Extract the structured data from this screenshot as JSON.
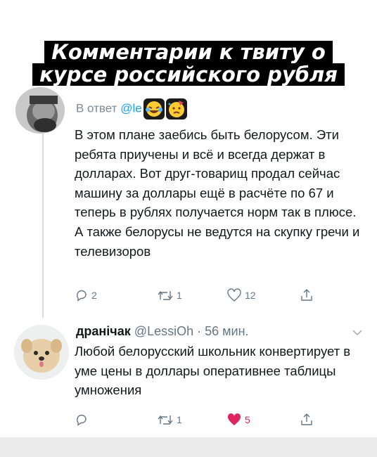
{
  "headline": {
    "line1": "Комментарии к твиту о",
    "line2": "курсе российского рубля"
  },
  "tweet1": {
    "reply_prefix": "В ответ",
    "reply_handle": "@le",
    "text": "В этом плане заебись быть белорусом. Эти ребята приучены и всё и всегда держат в долларах. Вот друг-товарищ продал сейчас машину за доллары ещё в расчёте по 67 и теперь в рублях получается норм так в плюсе. А также белорусы не ведутся на скупку гречи и телевизоров",
    "replies": "2",
    "retweets": "1",
    "likes": "12"
  },
  "tweet2": {
    "author": "дранічак",
    "handle": "@LessiOh",
    "separator": "·",
    "time": "56 мин.",
    "text": "Любой белорусский школьник конвертирует в уме цены в доллары оперативнее таблицы умножения",
    "retweets": "1",
    "likes": "5",
    "like_color": "#e0245e"
  },
  "icons": {
    "reply": "reply-icon",
    "retweet": "retweet-icon",
    "like": "heart-icon",
    "share": "share-icon",
    "caret": "chevron-down-icon"
  }
}
